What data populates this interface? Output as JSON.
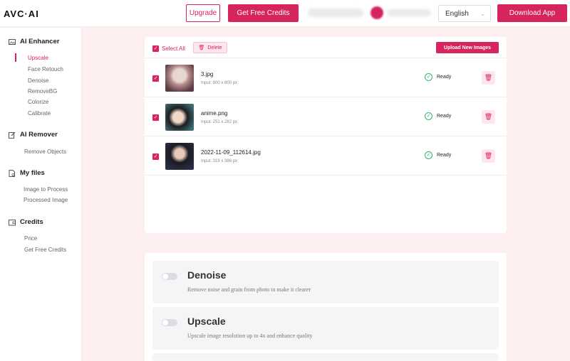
{
  "header": {
    "logo": "AVC·AI",
    "upgrade_label": "Upgrade",
    "get_credits_label": "Get Free Credits",
    "language": "English",
    "download_label": "Download App"
  },
  "sidebar": {
    "sections": [
      {
        "title": "AI Enhancer",
        "icon": "image-icon",
        "items": [
          "Upscale",
          "Face Retouch",
          "Denoise",
          "RemoveBG",
          "Colorize",
          "Calibrate"
        ],
        "active": "Upscale"
      },
      {
        "title": "AI Remover",
        "icon": "edit-icon",
        "items": [
          "Remove Objects"
        ]
      },
      {
        "title": "My files",
        "icon": "files-icon",
        "items": [
          "Image to Process",
          "Processed Image"
        ]
      },
      {
        "title": "Credits",
        "icon": "wallet-icon",
        "items": [
          "Price",
          "Get Free Credits"
        ]
      }
    ]
  },
  "upload": {
    "select_all_label": "Select All",
    "delete_label": "Delete",
    "upload_new_label": "Upload New Images",
    "files": [
      {
        "name": "3.jpg",
        "input": "Input: 800 x 800 px",
        "status": "Ready",
        "checked": true
      },
      {
        "name": "anime.png",
        "input": "Input: 251 x 282 px",
        "status": "Ready",
        "checked": true
      },
      {
        "name": "2022-11-09_112614.jpg",
        "input": "Input: 319 x 386 px",
        "status": "Ready",
        "checked": true
      }
    ]
  },
  "options": [
    {
      "title": "Denoise",
      "description": "Remove noise and grain from photo to make it clearer",
      "enabled": false
    },
    {
      "title": "Upscale",
      "description": "Upscale image resolution up to 4x and enhance quality",
      "enabled": false
    }
  ],
  "colors": {
    "accent": "#d6245c",
    "ready": "#2bb673",
    "background": "#fdeef0"
  }
}
